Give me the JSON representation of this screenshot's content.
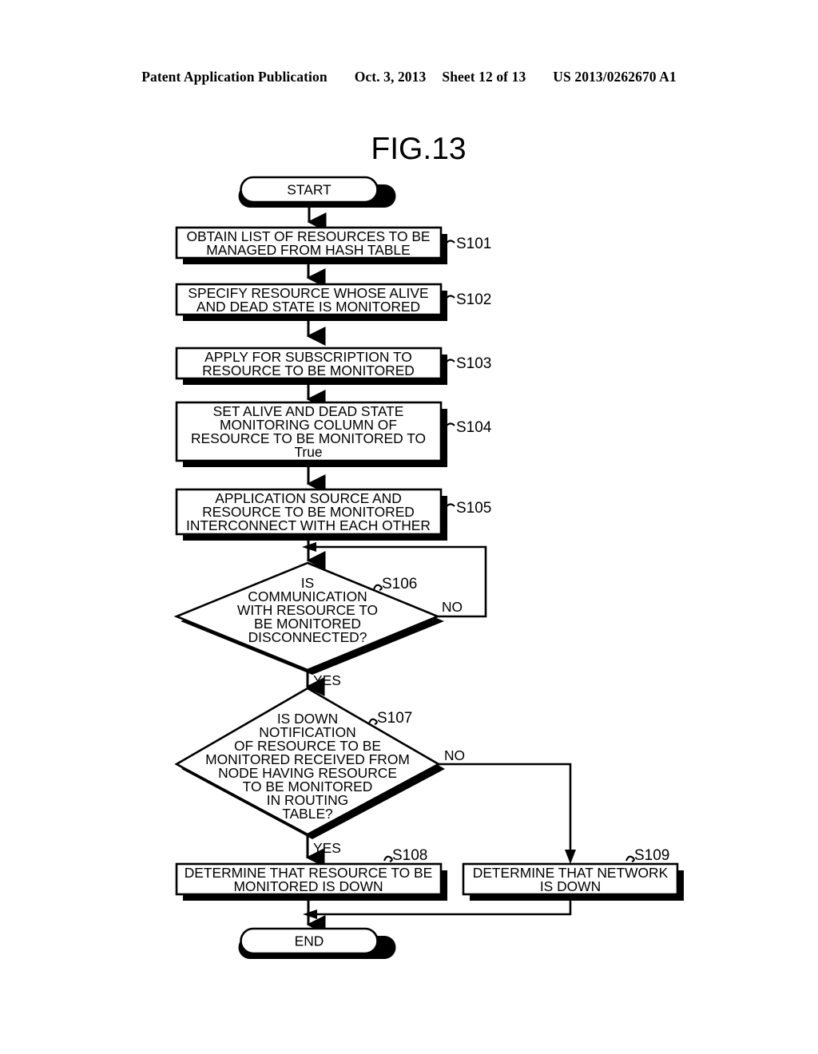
{
  "header": {
    "publication": "Patent Application Publication",
    "date": "Oct. 3, 2013",
    "sheet": "Sheet 12 of 13",
    "number": "US 2013/0262670 A1"
  },
  "figure": {
    "title": "FIG.13",
    "start_label": "START",
    "end_label": "END",
    "yes_label": "YES",
    "no_label": "NO",
    "steps": [
      {
        "id": "S101",
        "tag": "S101",
        "lines": [
          "OBTAIN LIST OF RESOURCES TO BE",
          "MANAGED FROM HASH TABLE"
        ]
      },
      {
        "id": "S102",
        "tag": "S102",
        "lines": [
          "SPECIFY RESOURCE WHOSE ALIVE",
          "AND DEAD STATE IS MONITORED"
        ]
      },
      {
        "id": "S103",
        "tag": "S103",
        "lines": [
          "APPLY FOR SUBSCRIPTION TO",
          "RESOURCE TO BE MONITORED"
        ]
      },
      {
        "id": "S104",
        "tag": "S104",
        "lines": [
          "SET ALIVE AND DEAD STATE",
          "MONITORING COLUMN OF",
          "RESOURCE TO BE MONITORED TO",
          "True"
        ]
      },
      {
        "id": "S105",
        "tag": "S105",
        "lines": [
          "APPLICATION SOURCE AND",
          "RESOURCE TO BE MONITORED",
          "INTERCONNECT WITH EACH OTHER"
        ]
      },
      {
        "id": "S106",
        "tag": "S106",
        "lines": [
          "IS",
          "COMMUNICATION",
          "WITH RESOURCE TO",
          "BE MONITORED",
          "DISCONNECTED?"
        ]
      },
      {
        "id": "S107",
        "tag": "S107",
        "lines": [
          "IS DOWN",
          "NOTIFICATION",
          "OF RESOURCE TO BE",
          "MONITORED RECEIVED FROM",
          "NODE HAVING RESOURCE",
          "TO BE MONITORED",
          "IN ROUTING",
          "TABLE?"
        ]
      },
      {
        "id": "S108",
        "tag": "S108",
        "lines": [
          "DETERMINE THAT RESOURCE TO BE",
          "MONITORED IS DOWN"
        ]
      },
      {
        "id": "S109",
        "tag": "S109",
        "lines": [
          "DETERMINE THAT NETWORK",
          "IS DOWN"
        ]
      }
    ],
    "branches": {
      "s106_no": "NO",
      "s106_yes": "YES",
      "s107_no": "NO",
      "s107_yes": "YES"
    }
  },
  "colors": {
    "ink": "#000000",
    "paper": "#ffffff"
  }
}
